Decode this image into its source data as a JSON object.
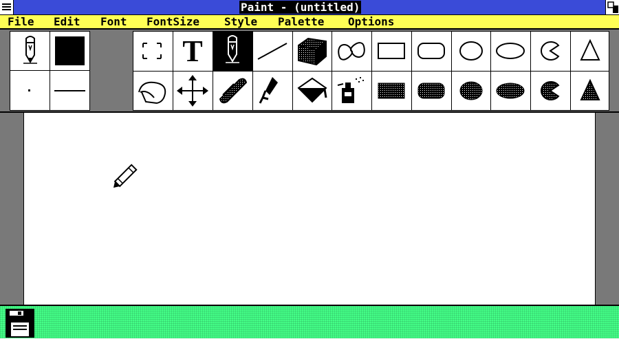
{
  "window": {
    "title": "Paint - (untitled)"
  },
  "menu": {
    "items": [
      "File",
      "Edit",
      "Font",
      "FontSize",
      "Style",
      "Palette",
      "Options"
    ]
  },
  "toolbox": {
    "selected_tool": "pencil",
    "tools": [
      "selection-rectangle",
      "text",
      "pencil",
      "line",
      "3d-box",
      "curve",
      "rectangle",
      "rounded-rectangle",
      "circle",
      "ellipse",
      "pie",
      "polygon",
      "lasso",
      "move",
      "eraser",
      "paintbrush",
      "paint-bucket",
      "spray-can",
      "filled-rectangle",
      "filled-rounded-rectangle",
      "filled-circle",
      "filled-ellipse",
      "filled-pie",
      "filled-polygon"
    ]
  },
  "colors": {
    "title_bar": "#3a4bd8",
    "menu_bar": "#ffff55",
    "status_bar": "#44ff88",
    "current_color": "#000000"
  }
}
